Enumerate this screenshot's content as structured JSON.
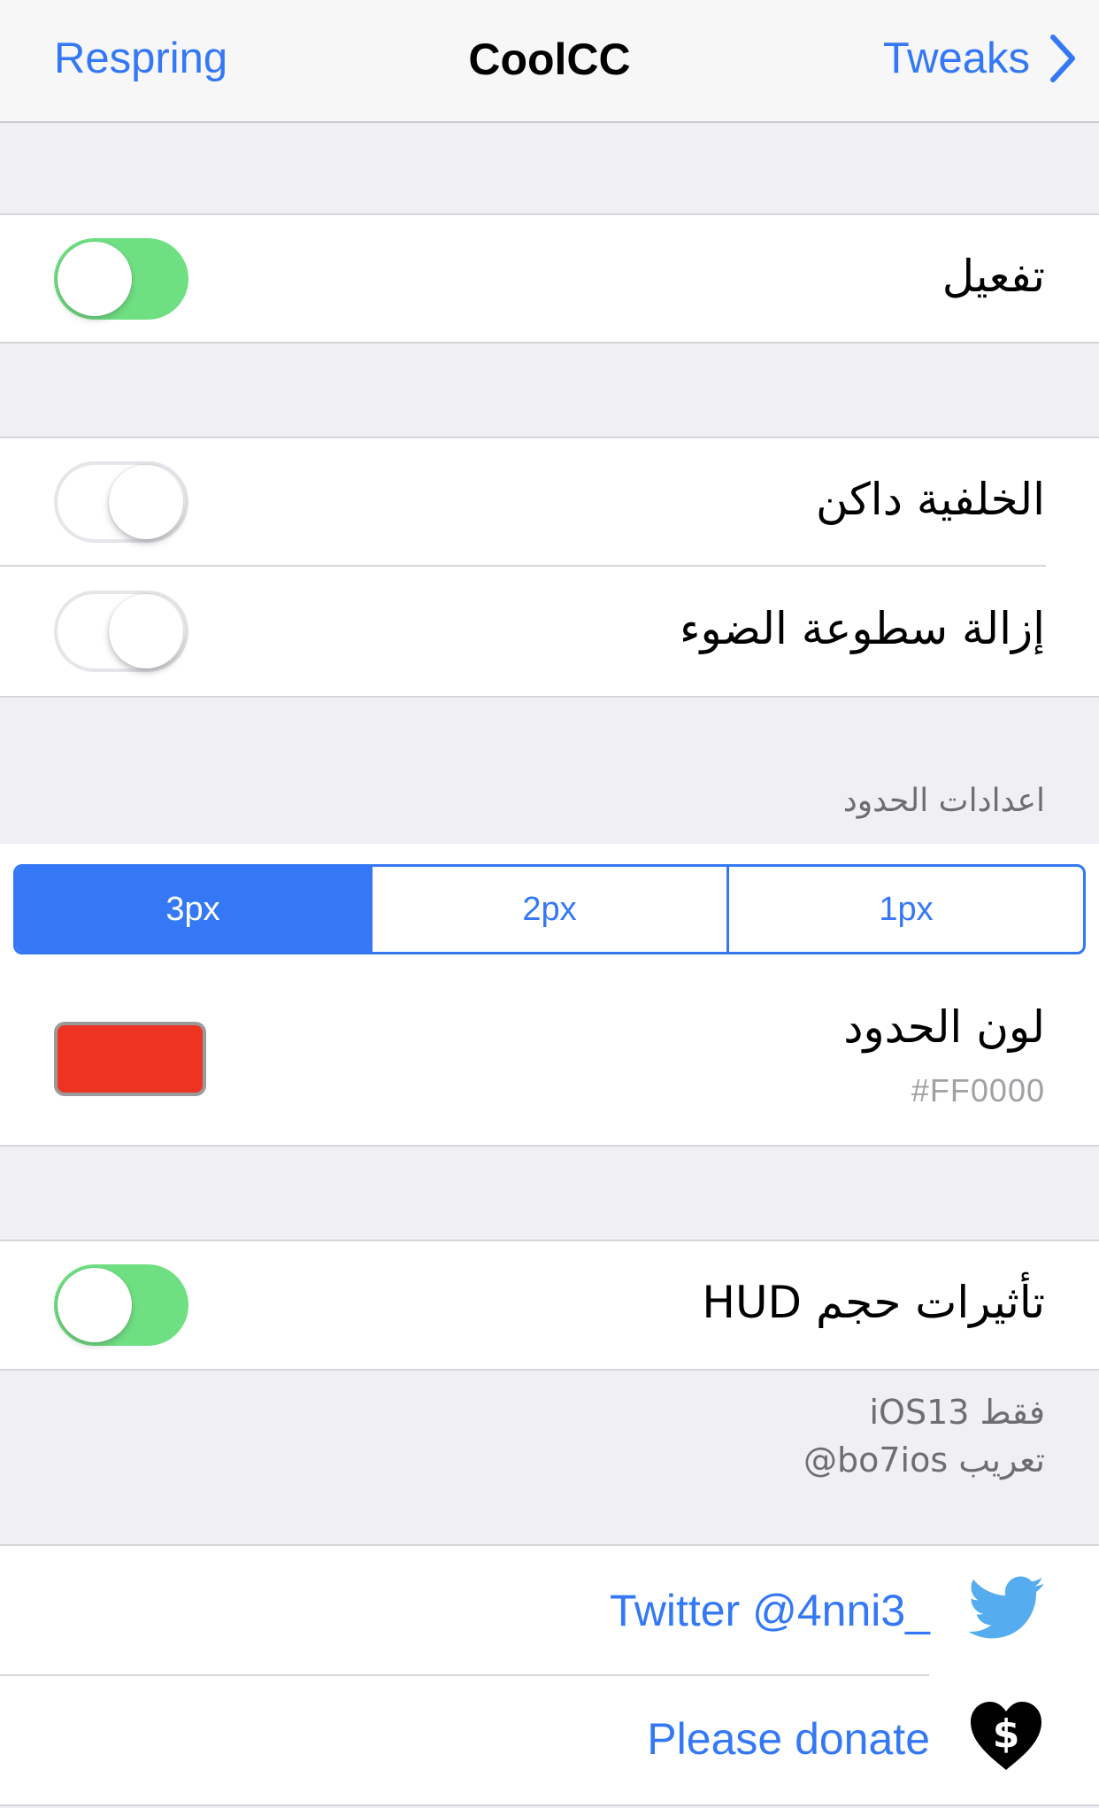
{
  "navbar": {
    "left_button": "Respring",
    "title": "CoolCC",
    "right_button": "Tweaks"
  },
  "enable": {
    "label": "تفعيل",
    "state": "on"
  },
  "dark_background": {
    "label": "الخلفية داكن",
    "state": "off"
  },
  "remove_brightness": {
    "label": "إزالة سطوعة الضوء",
    "state": "off"
  },
  "border_settings": {
    "header": "اعدادات الحدود",
    "segments": [
      "3px",
      "2px",
      "1px"
    ],
    "selected": "3px",
    "color_label": "لون الحدود",
    "color_value": "#FF0000",
    "color_swatch": "#ee3322"
  },
  "hud": {
    "label": "تأثيرات حجم HUD",
    "state": "on",
    "footer_line1": "فقط iOS13",
    "footer_line2": "تعريب bo7ios@"
  },
  "links": {
    "twitter_label": "Twitter @4nni3_",
    "twitter_icon": "twitter-bird-icon",
    "donate_label": "Please donate",
    "donate_icon": "heart-dollar-icon"
  },
  "colors": {
    "accent": "#3478f6",
    "switch_on": "#4cd964",
    "background": "#efeff4",
    "twitter": "#55acee"
  }
}
